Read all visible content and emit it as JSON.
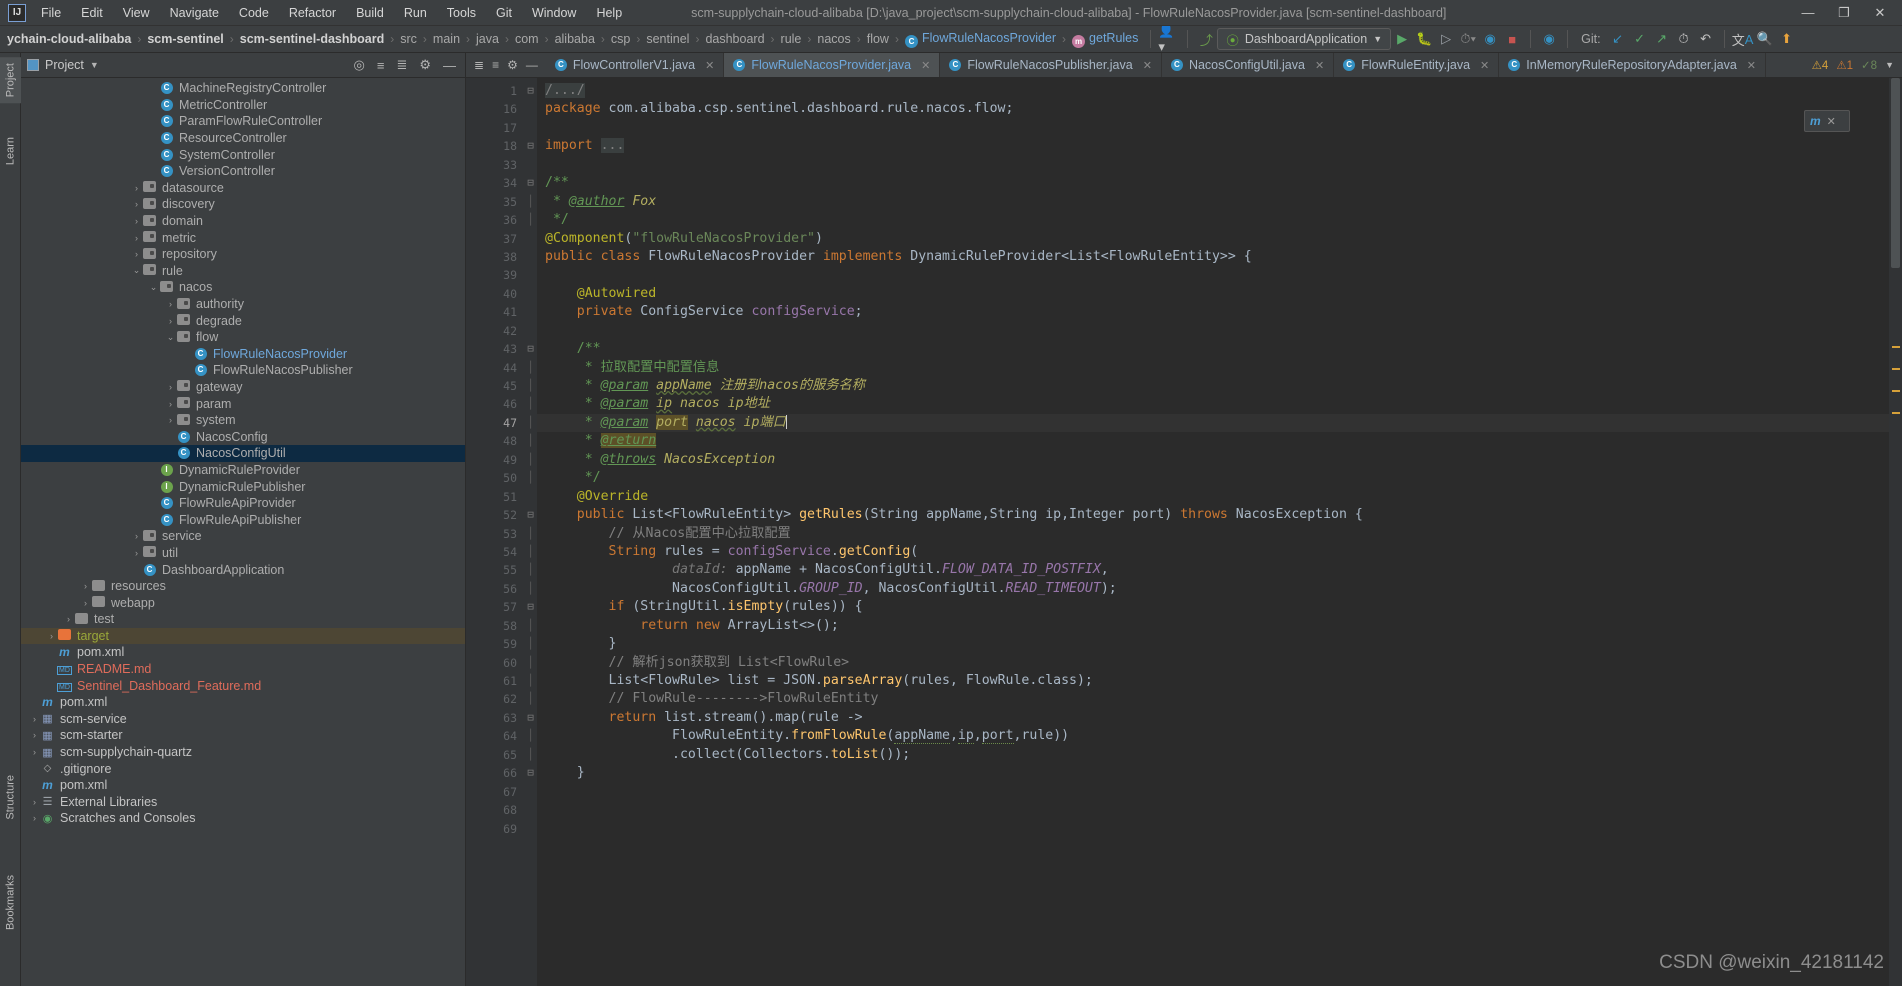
{
  "window": {
    "title": "scm-supplychain-cloud-alibaba [D:\\java_project\\scm-supplychain-cloud-alibaba] - FlowRuleNacosProvider.java [scm-sentinel-dashboard]",
    "logo": "IJ",
    "minimize": "—",
    "maximize": "❐",
    "close": "✕"
  },
  "menu": [
    "File",
    "Edit",
    "View",
    "Navigate",
    "Code",
    "Refactor",
    "Build",
    "Run",
    "Tools",
    "Git",
    "Window",
    "Help"
  ],
  "breadcrumbs": [
    {
      "label": "ychain-cloud-alibaba",
      "style": "bold"
    },
    {
      "label": "scm-sentinel",
      "style": "bold"
    },
    {
      "label": "scm-sentinel-dashboard",
      "style": "bold"
    },
    {
      "label": "src",
      "style": "plain"
    },
    {
      "label": "main",
      "style": "plain"
    },
    {
      "label": "java",
      "style": "plain"
    },
    {
      "label": "com",
      "style": "plain"
    },
    {
      "label": "alibaba",
      "style": "plain"
    },
    {
      "label": "csp",
      "style": "plain"
    },
    {
      "label": "sentinel",
      "style": "plain"
    },
    {
      "label": "dashboard",
      "style": "plain"
    },
    {
      "label": "rule",
      "style": "plain"
    },
    {
      "label": "nacos",
      "style": "plain"
    },
    {
      "label": "flow",
      "style": "plain"
    },
    {
      "label": "FlowRuleNacosProvider",
      "style": "class"
    },
    {
      "label": "getRules",
      "style": "method"
    }
  ],
  "toolbar": {
    "run_config": "DashboardApplication",
    "git_label": "Git:",
    "icons": [
      "person-icon",
      "build-hammer-icon",
      "run-icon",
      "debug-icon",
      "run-with-coverage-icon",
      "profile-icon",
      "stop-icon",
      "attach-icon",
      "update-project-icon",
      "commit-icon",
      "push-icon",
      "history-icon",
      "undo-icon",
      "translate-icon",
      "search-icon",
      "upload-icon"
    ]
  },
  "project_panel": {
    "title": "Project",
    "header_icons": [
      "locate-icon",
      "collapse-all-icon",
      "settings-icon",
      "hide-icon"
    ],
    "tree": [
      {
        "indent": 7,
        "arrow": "",
        "icon": "class",
        "label": "MachineRegistryController",
        "style": "grey"
      },
      {
        "indent": 7,
        "arrow": "",
        "icon": "class",
        "label": "MetricController",
        "style": "grey"
      },
      {
        "indent": 7,
        "arrow": "",
        "icon": "class",
        "label": "ParamFlowRuleController",
        "style": "grey"
      },
      {
        "indent": 7,
        "arrow": "",
        "icon": "class",
        "label": "ResourceController",
        "style": "grey"
      },
      {
        "indent": 7,
        "arrow": "",
        "icon": "class",
        "label": "SystemController",
        "style": "grey"
      },
      {
        "indent": 7,
        "arrow": "",
        "icon": "class",
        "label": "VersionController",
        "style": "grey"
      },
      {
        "indent": 6,
        "arrow": "›",
        "icon": "folder",
        "label": "datasource",
        "style": "grey"
      },
      {
        "indent": 6,
        "arrow": "›",
        "icon": "folder",
        "label": "discovery",
        "style": "grey"
      },
      {
        "indent": 6,
        "arrow": "›",
        "icon": "folder",
        "label": "domain",
        "style": "grey"
      },
      {
        "indent": 6,
        "arrow": "›",
        "icon": "folder",
        "label": "metric",
        "style": "grey"
      },
      {
        "indent": 6,
        "arrow": "›",
        "icon": "folder",
        "label": "repository",
        "style": "grey"
      },
      {
        "indent": 6,
        "arrow": "⌄",
        "icon": "folder",
        "label": "rule",
        "style": "grey"
      },
      {
        "indent": 7,
        "arrow": "⌄",
        "icon": "folder",
        "label": "nacos",
        "style": "grey"
      },
      {
        "indent": 8,
        "arrow": "›",
        "icon": "folder",
        "label": "authority",
        "style": "grey"
      },
      {
        "indent": 8,
        "arrow": "›",
        "icon": "folder",
        "label": "degrade",
        "style": "grey"
      },
      {
        "indent": 8,
        "arrow": "⌄",
        "icon": "folder",
        "label": "flow",
        "style": "grey"
      },
      {
        "indent": 9,
        "arrow": "",
        "icon": "class",
        "label": "FlowRuleNacosProvider",
        "style": "blue"
      },
      {
        "indent": 9,
        "arrow": "",
        "icon": "class",
        "label": "FlowRuleNacosPublisher",
        "style": "grey"
      },
      {
        "indent": 8,
        "arrow": "›",
        "icon": "folder",
        "label": "gateway",
        "style": "grey"
      },
      {
        "indent": 8,
        "arrow": "›",
        "icon": "folder",
        "label": "param",
        "style": "grey"
      },
      {
        "indent": 8,
        "arrow": "›",
        "icon": "folder",
        "label": "system",
        "style": "grey"
      },
      {
        "indent": 8,
        "arrow": "",
        "icon": "class",
        "label": "NacosConfig",
        "style": "grey"
      },
      {
        "indent": 8,
        "arrow": "",
        "icon": "class",
        "label": "NacosConfigUtil",
        "style": "grey",
        "selected": true
      },
      {
        "indent": 7,
        "arrow": "",
        "icon": "interface",
        "label": "DynamicRuleProvider",
        "style": "grey"
      },
      {
        "indent": 7,
        "arrow": "",
        "icon": "interface",
        "label": "DynamicRulePublisher",
        "style": "grey"
      },
      {
        "indent": 7,
        "arrow": "",
        "icon": "class",
        "label": "FlowRuleApiProvider",
        "style": "grey"
      },
      {
        "indent": 7,
        "arrow": "",
        "icon": "class",
        "label": "FlowRuleApiPublisher",
        "style": "grey"
      },
      {
        "indent": 6,
        "arrow": "›",
        "icon": "folder",
        "label": "service",
        "style": "grey"
      },
      {
        "indent": 6,
        "arrow": "›",
        "icon": "folder",
        "label": "util",
        "style": "grey"
      },
      {
        "indent": 6,
        "arrow": "",
        "icon": "spring",
        "label": "DashboardApplication",
        "style": "grey"
      },
      {
        "indent": 3,
        "arrow": "›",
        "icon": "resfolder",
        "label": "resources",
        "style": "grey"
      },
      {
        "indent": 3,
        "arrow": "›",
        "icon": "resfolder",
        "label": "webapp",
        "style": "grey"
      },
      {
        "indent": 2,
        "arrow": "›",
        "icon": "plainfolder",
        "label": "test",
        "style": "grey"
      },
      {
        "indent": 1,
        "arrow": "›",
        "icon": "orangefolder",
        "label": "target",
        "style": "green",
        "highlight": true
      },
      {
        "indent": 1,
        "arrow": "",
        "icon": "maven",
        "label": "pom.xml",
        "style": "white"
      },
      {
        "indent": 1,
        "arrow": "",
        "icon": "md",
        "label": "README.md",
        "style": "red"
      },
      {
        "indent": 1,
        "arrow": "",
        "icon": "md",
        "label": "Sentinel_Dashboard_Feature.md",
        "style": "red"
      },
      {
        "indent": 0,
        "arrow": "",
        "icon": "maven",
        "label": "pom.xml",
        "style": "white"
      },
      {
        "indent": 0,
        "arrow": "›",
        "icon": "module",
        "label": "scm-service",
        "style": "white"
      },
      {
        "indent": 0,
        "arrow": "›",
        "icon": "module",
        "label": "scm-starter",
        "style": "white"
      },
      {
        "indent": 0,
        "arrow": "›",
        "icon": "module",
        "label": "scm-supplychain-quartz",
        "style": "white"
      },
      {
        "indent": 0,
        "arrow": "",
        "icon": "gitignore",
        "label": ".gitignore",
        "style": "white"
      },
      {
        "indent": 0,
        "arrow": "",
        "icon": "maven",
        "label": "pom.xml",
        "style": "white"
      },
      {
        "indent": 0,
        "arrow": "›",
        "icon": "library",
        "label": "External Libraries",
        "style": "white"
      },
      {
        "indent": 0,
        "arrow": "›",
        "icon": "scratch",
        "label": "Scratches and Consoles",
        "style": "white"
      }
    ]
  },
  "left_rail": [
    "Project",
    "Learn",
    "Structure",
    "Bookmarks"
  ],
  "editor": {
    "tabs": [
      {
        "label": "FlowControllerV1.java",
        "icon": "class-icon",
        "active": false
      },
      {
        "label": "FlowRuleNacosProvider.java",
        "icon": "class-icon",
        "active": true
      },
      {
        "label": "FlowRuleNacosPublisher.java",
        "icon": "class-icon",
        "active": false
      },
      {
        "label": "NacosConfigUtil.java",
        "icon": "class-icon",
        "active": false
      },
      {
        "label": "FlowRuleEntity.java",
        "icon": "class-icon",
        "active": false
      },
      {
        "label": "InMemoryRuleRepositoryAdapter.java",
        "icon": "class-icon",
        "active": false
      }
    ],
    "inspection": {
      "warnings": "4",
      "errors": "1",
      "checks": "8",
      "ok_icon": "✔"
    },
    "float_widget": "m",
    "lines": [
      {
        "n": "1",
        "text": "/.../",
        "kind": "folded"
      },
      {
        "n": "16",
        "text": "package com.alibaba.csp.sentinel.dashboard.rule.nacos.flow;",
        "kind": "package"
      },
      {
        "n": "17",
        "text": "",
        "kind": "blank"
      },
      {
        "n": "18",
        "text": "import ...",
        "kind": "import"
      },
      {
        "n": "33",
        "text": "",
        "kind": "blank"
      },
      {
        "n": "34",
        "text": "/**",
        "kind": "jdoc"
      },
      {
        "n": "35",
        "text": " * @author Fox",
        "kind": "jdoc-author"
      },
      {
        "n": "36",
        "text": " */",
        "kind": "jdoc"
      },
      {
        "n": "37",
        "text": "@Component(\"flowRuleNacosProvider\")",
        "kind": "annotation"
      },
      {
        "n": "38",
        "text": "public class FlowRuleNacosProvider implements DynamicRuleProvider<List<FlowRuleEntity>> {",
        "kind": "classdecl"
      },
      {
        "n": "39",
        "text": "",
        "kind": "blank"
      },
      {
        "n": "40",
        "text": "    @Autowired",
        "kind": "annotation"
      },
      {
        "n": "41",
        "text": "    private ConfigService configService;",
        "kind": "field"
      },
      {
        "n": "42",
        "text": "",
        "kind": "blank"
      },
      {
        "n": "43",
        "text": "    /**",
        "kind": "jdoc"
      },
      {
        "n": "44",
        "text": "     * 拉取配置中配置信息",
        "kind": "jdoc"
      },
      {
        "n": "45",
        "text": "     * @param appName 注册到nacos的服务名称",
        "kind": "jdoc-param"
      },
      {
        "n": "46",
        "text": "     * @param ip nacos ip地址",
        "kind": "jdoc-param"
      },
      {
        "n": "47",
        "text": "     * @param port nacos ip端口",
        "kind": "jdoc-param-sel"
      },
      {
        "n": "48",
        "text": "     * @return",
        "kind": "jdoc-return"
      },
      {
        "n": "49",
        "text": "     * @throws NacosException",
        "kind": "jdoc-throws"
      },
      {
        "n": "50",
        "text": "     */",
        "kind": "jdoc"
      },
      {
        "n": "51",
        "text": "    @Override",
        "kind": "annotation"
      },
      {
        "n": "52",
        "text": "    public List<FlowRuleEntity> getRules(String appName,String ip,Integer port) throws NacosException {",
        "kind": "methoddecl"
      },
      {
        "n": "53",
        "text": "        // 从Nacos配置中心拉取配置",
        "kind": "comment"
      },
      {
        "n": "54",
        "text": "        String rules = configService.getConfig(",
        "kind": "stmt"
      },
      {
        "n": "55",
        "text": "                dataId: appName + NacosConfigUtil.FLOW_DATA_ID_POSTFIX,",
        "kind": "stmt-hint"
      },
      {
        "n": "56",
        "text": "                NacosConfigUtil.GROUP_ID, NacosConfigUtil.READ_TIMEOUT);",
        "kind": "stmt"
      },
      {
        "n": "57",
        "text": "        if (StringUtil.isEmpty(rules)) {",
        "kind": "stmt"
      },
      {
        "n": "58",
        "text": "            return new ArrayList<>();",
        "kind": "stmt"
      },
      {
        "n": "59",
        "text": "        }",
        "kind": "stmt"
      },
      {
        "n": "60",
        "text": "        // 解析json获取到 List<FlowRule>",
        "kind": "comment"
      },
      {
        "n": "61",
        "text": "        List<FlowRule> list = JSON.parseArray(rules, FlowRule.class);",
        "kind": "stmt"
      },
      {
        "n": "62",
        "text": "        // FlowRule-------->FlowRuleEntity",
        "kind": "comment"
      },
      {
        "n": "63",
        "text": "        return list.stream().map(rule ->",
        "kind": "stmt"
      },
      {
        "n": "64",
        "text": "                FlowRuleEntity.fromFlowRule(appName,ip,port,rule))",
        "kind": "stmt"
      },
      {
        "n": "65",
        "text": "                .collect(Collectors.toList());",
        "kind": "stmt"
      },
      {
        "n": "66",
        "text": "    }",
        "kind": "stmt"
      },
      {
        "n": "67",
        "text": "",
        "kind": "blank"
      },
      {
        "n": "68",
        "text": "",
        "kind": "blank"
      },
      {
        "n": "69",
        "text": "",
        "kind": "blank"
      }
    ]
  },
  "watermark": "CSDN @weixin_42181142",
  "colors": {
    "bg": "#3c3f41",
    "editor_bg": "#2b2b2b",
    "accent_blue": "#6fa8dc",
    "selection": "#0d2a42",
    "target_highlight": "#4d4634",
    "string_green": "#6a8759",
    "keyword_orange": "#cc7832",
    "annotation_yellow": "#bbb529"
  }
}
